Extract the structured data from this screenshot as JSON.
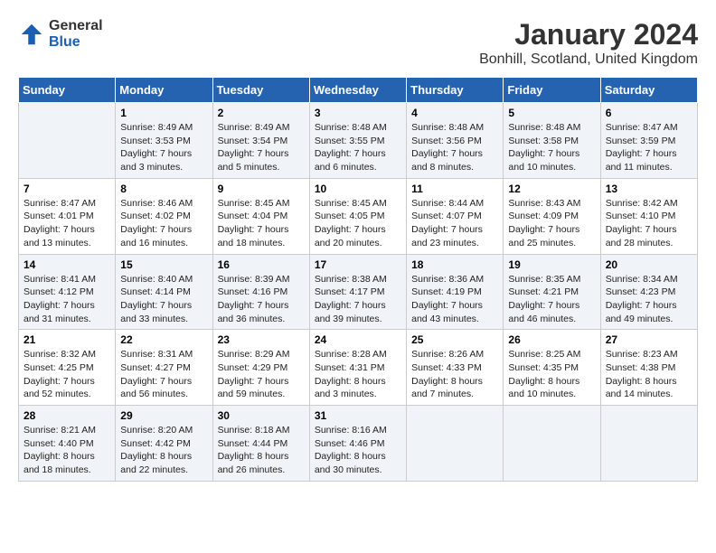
{
  "header": {
    "logo_general": "General",
    "logo_blue": "Blue",
    "title": "January 2024",
    "subtitle": "Bonhill, Scotland, United Kingdom"
  },
  "calendar": {
    "days_of_week": [
      "Sunday",
      "Monday",
      "Tuesday",
      "Wednesday",
      "Thursday",
      "Friday",
      "Saturday"
    ],
    "weeks": [
      [
        {
          "day": "",
          "info": ""
        },
        {
          "day": "1",
          "info": "Sunrise: 8:49 AM\nSunset: 3:53 PM\nDaylight: 7 hours\nand 3 minutes."
        },
        {
          "day": "2",
          "info": "Sunrise: 8:49 AM\nSunset: 3:54 PM\nDaylight: 7 hours\nand 5 minutes."
        },
        {
          "day": "3",
          "info": "Sunrise: 8:48 AM\nSunset: 3:55 PM\nDaylight: 7 hours\nand 6 minutes."
        },
        {
          "day": "4",
          "info": "Sunrise: 8:48 AM\nSunset: 3:56 PM\nDaylight: 7 hours\nand 8 minutes."
        },
        {
          "day": "5",
          "info": "Sunrise: 8:48 AM\nSunset: 3:58 PM\nDaylight: 7 hours\nand 10 minutes."
        },
        {
          "day": "6",
          "info": "Sunrise: 8:47 AM\nSunset: 3:59 PM\nDaylight: 7 hours\nand 11 minutes."
        }
      ],
      [
        {
          "day": "7",
          "info": "Sunrise: 8:47 AM\nSunset: 4:01 PM\nDaylight: 7 hours\nand 13 minutes."
        },
        {
          "day": "8",
          "info": "Sunrise: 8:46 AM\nSunset: 4:02 PM\nDaylight: 7 hours\nand 16 minutes."
        },
        {
          "day": "9",
          "info": "Sunrise: 8:45 AM\nSunset: 4:04 PM\nDaylight: 7 hours\nand 18 minutes."
        },
        {
          "day": "10",
          "info": "Sunrise: 8:45 AM\nSunset: 4:05 PM\nDaylight: 7 hours\nand 20 minutes."
        },
        {
          "day": "11",
          "info": "Sunrise: 8:44 AM\nSunset: 4:07 PM\nDaylight: 7 hours\nand 23 minutes."
        },
        {
          "day": "12",
          "info": "Sunrise: 8:43 AM\nSunset: 4:09 PM\nDaylight: 7 hours\nand 25 minutes."
        },
        {
          "day": "13",
          "info": "Sunrise: 8:42 AM\nSunset: 4:10 PM\nDaylight: 7 hours\nand 28 minutes."
        }
      ],
      [
        {
          "day": "14",
          "info": "Sunrise: 8:41 AM\nSunset: 4:12 PM\nDaylight: 7 hours\nand 31 minutes."
        },
        {
          "day": "15",
          "info": "Sunrise: 8:40 AM\nSunset: 4:14 PM\nDaylight: 7 hours\nand 33 minutes."
        },
        {
          "day": "16",
          "info": "Sunrise: 8:39 AM\nSunset: 4:16 PM\nDaylight: 7 hours\nand 36 minutes."
        },
        {
          "day": "17",
          "info": "Sunrise: 8:38 AM\nSunset: 4:17 PM\nDaylight: 7 hours\nand 39 minutes."
        },
        {
          "day": "18",
          "info": "Sunrise: 8:36 AM\nSunset: 4:19 PM\nDaylight: 7 hours\nand 43 minutes."
        },
        {
          "day": "19",
          "info": "Sunrise: 8:35 AM\nSunset: 4:21 PM\nDaylight: 7 hours\nand 46 minutes."
        },
        {
          "day": "20",
          "info": "Sunrise: 8:34 AM\nSunset: 4:23 PM\nDaylight: 7 hours\nand 49 minutes."
        }
      ],
      [
        {
          "day": "21",
          "info": "Sunrise: 8:32 AM\nSunset: 4:25 PM\nDaylight: 7 hours\nand 52 minutes."
        },
        {
          "day": "22",
          "info": "Sunrise: 8:31 AM\nSunset: 4:27 PM\nDaylight: 7 hours\nand 56 minutes."
        },
        {
          "day": "23",
          "info": "Sunrise: 8:29 AM\nSunset: 4:29 PM\nDaylight: 7 hours\nand 59 minutes."
        },
        {
          "day": "24",
          "info": "Sunrise: 8:28 AM\nSunset: 4:31 PM\nDaylight: 8 hours\nand 3 minutes."
        },
        {
          "day": "25",
          "info": "Sunrise: 8:26 AM\nSunset: 4:33 PM\nDaylight: 8 hours\nand 7 minutes."
        },
        {
          "day": "26",
          "info": "Sunrise: 8:25 AM\nSunset: 4:35 PM\nDaylight: 8 hours\nand 10 minutes."
        },
        {
          "day": "27",
          "info": "Sunrise: 8:23 AM\nSunset: 4:38 PM\nDaylight: 8 hours\nand 14 minutes."
        }
      ],
      [
        {
          "day": "28",
          "info": "Sunrise: 8:21 AM\nSunset: 4:40 PM\nDaylight: 8 hours\nand 18 minutes."
        },
        {
          "day": "29",
          "info": "Sunrise: 8:20 AM\nSunset: 4:42 PM\nDaylight: 8 hours\nand 22 minutes."
        },
        {
          "day": "30",
          "info": "Sunrise: 8:18 AM\nSunset: 4:44 PM\nDaylight: 8 hours\nand 26 minutes."
        },
        {
          "day": "31",
          "info": "Sunrise: 8:16 AM\nSunset: 4:46 PM\nDaylight: 8 hours\nand 30 minutes."
        },
        {
          "day": "",
          "info": ""
        },
        {
          "day": "",
          "info": ""
        },
        {
          "day": "",
          "info": ""
        }
      ]
    ]
  }
}
